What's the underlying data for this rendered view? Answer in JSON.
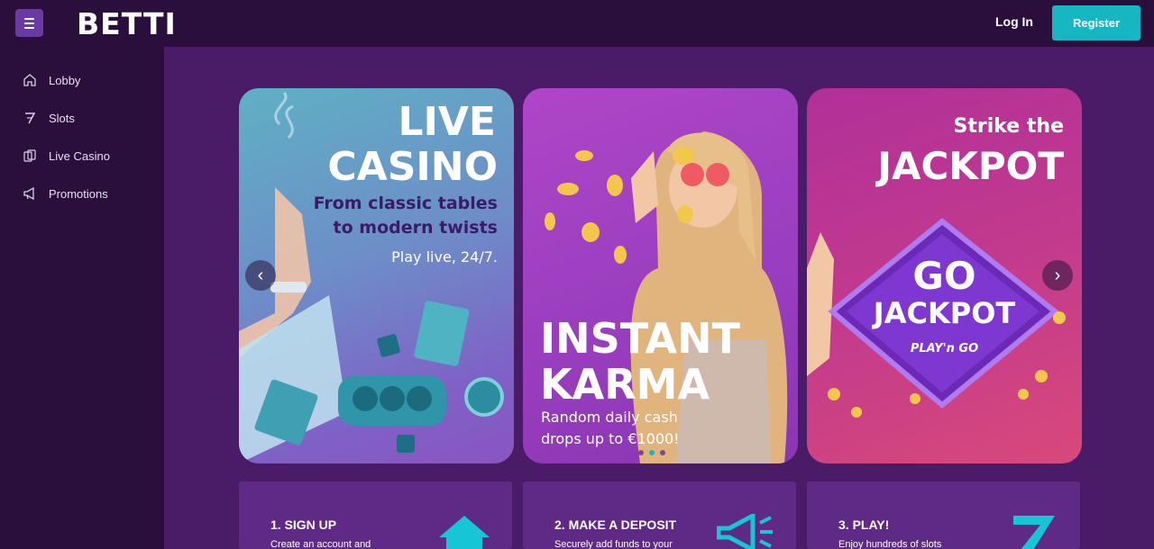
{
  "header": {
    "logo": "BETTI",
    "login_label": "Log In",
    "register_label": "Register"
  },
  "sidebar": {
    "items": [
      {
        "label": "Lobby",
        "icon": "home-icon"
      },
      {
        "label": "Slots",
        "icon": "seven-icon"
      },
      {
        "label": "Live Casino",
        "icon": "cards-icon"
      },
      {
        "label": "Promotions",
        "icon": "megaphone-icon"
      }
    ]
  },
  "carousel": {
    "cards": [
      {
        "title_line1": "LIVE",
        "title_line2": "CASINO",
        "subtitle_line1": "From classic tables",
        "subtitle_line2": "to modern twists",
        "note": "Play live, 24/7."
      },
      {
        "title_line1": "INSTANT",
        "title_line2": "KARMA",
        "note_line1": "Random daily cash",
        "note_line2": "drops up to €1000!"
      },
      {
        "pre_title": "Strike the",
        "title": "JACKPOT",
        "badge_line1": "GO",
        "badge_line2": "JACKPOT",
        "badge_brand": "PLAY'n GO"
      }
    ],
    "active_dot": 1,
    "dot_count": 3
  },
  "steps": [
    {
      "title": "1. SIGN UP",
      "desc": "Create an account and",
      "icon": "house-icon"
    },
    {
      "title": "2. MAKE A DEPOSIT",
      "desc": "Securely add funds to your",
      "icon": "megaphone-icon"
    },
    {
      "title": "3. PLAY!",
      "desc": "Enjoy hundreds of slots",
      "icon": "seven-icon"
    }
  ],
  "colors": {
    "background": "#2a0f3d",
    "main": "#4a1b66",
    "accent": "#17b6c3",
    "step_card": "#5e2a85"
  }
}
